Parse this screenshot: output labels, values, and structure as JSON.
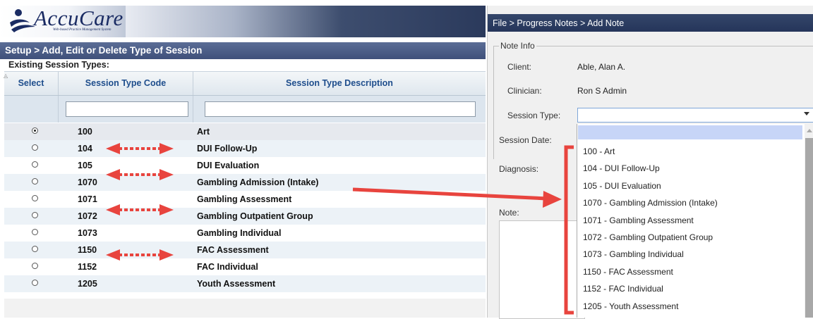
{
  "brand": {
    "name": "AccuCare",
    "tagline": "Web-based Practice Management System",
    "color": "#1a2b63"
  },
  "setup": {
    "breadcrumb": "Setup > Add, Edit or Delete Type of Session",
    "existing_label": "Existing Session Types:",
    "columns": {
      "select": "Select",
      "code": "Session Type Code",
      "description": "Session Type Description"
    },
    "filters": {
      "code": "",
      "description": ""
    },
    "rows": [
      {
        "code": "100",
        "description": "Art",
        "selected": true
      },
      {
        "code": "104",
        "description": "DUI Follow-Up",
        "selected": false
      },
      {
        "code": "105",
        "description": "DUI Evaluation",
        "selected": false
      },
      {
        "code": "1070",
        "description": "Gambling Admission (Intake)",
        "selected": false
      },
      {
        "code": "1071",
        "description": "Gambling Assessment",
        "selected": false
      },
      {
        "code": "1072",
        "description": "Gambling Outpatient Group",
        "selected": false
      },
      {
        "code": "1073",
        "description": "Gambling Individual",
        "selected": false
      },
      {
        "code": "1150",
        "description": "FAC Assessment",
        "selected": false
      },
      {
        "code": "1152",
        "description": "FAC Individual",
        "selected": false
      },
      {
        "code": "1205",
        "description": "Youth Assessment",
        "selected": false
      }
    ]
  },
  "note_dialog": {
    "title": "File > Progress Notes > Add Note",
    "legend": "Note Info",
    "client_label": "Client:",
    "client_value": "Able, Alan A.",
    "clinician_label": "Clinician:",
    "clinician_value": "Ron S Admin",
    "session_type_label": "Session Type:",
    "session_type_value": "",
    "session_date_label": "Session Date:",
    "diagnosis_label": "Diagnosis:",
    "note_label": "Note:",
    "dropdown_options": [
      "100 - Art",
      "104 - DUI Follow-Up",
      "105 - DUI Evaluation",
      "1070 - Gambling Admission (Intake)",
      "1071 - Gambling Assessment",
      "1072 - Gambling Outpatient Group",
      "1073 - Gambling Individual",
      "1150 - FAC Assessment",
      "1152 - FAC Individual",
      "1205 - Youth Assessment"
    ]
  },
  "annotation_color": "#e8443e"
}
